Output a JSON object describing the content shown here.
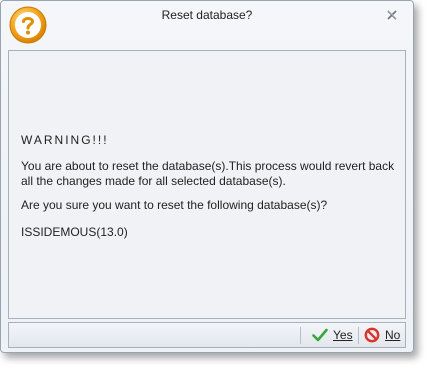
{
  "window": {
    "title": "Reset database?",
    "icon": "question-icon",
    "close_icon": "close-icon"
  },
  "message": {
    "warning": "WARNING!!!",
    "body": "You are about to reset the database(s).This process would revert back all the changes made for all selected database(s).",
    "question": "Are you sure you want to reset the following database(s)?",
    "database": "ISSIDEMOUS(13.0)"
  },
  "buttons": {
    "yes": {
      "label": "Yes",
      "icon": "checkmark-icon"
    },
    "no": {
      "label": "No",
      "icon": "no-entry-icon"
    }
  },
  "colors": {
    "icon_orange": "#f5a623",
    "check_green": "#3aa53a",
    "no_red": "#d9342b"
  }
}
